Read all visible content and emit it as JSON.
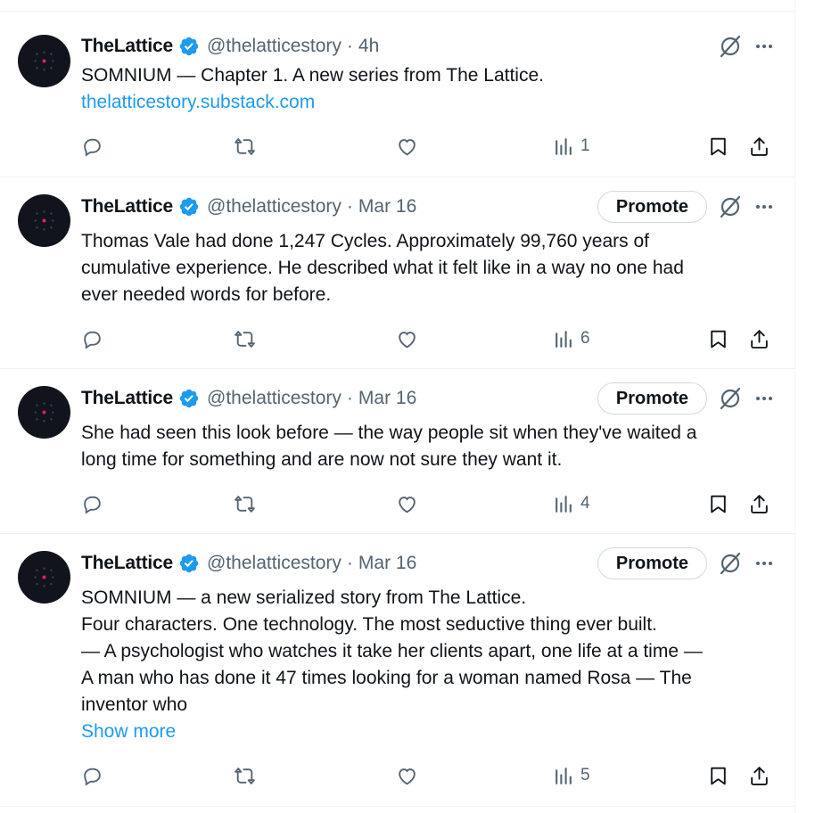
{
  "colors": {
    "text": "#0f1419",
    "muted": "#536471",
    "link": "#1d9bf0",
    "verified": "#1d9bf0",
    "border": "#eff3f4",
    "avatar_bg": "#12141d",
    "avatar_accent": "#e0245e"
  },
  "icons": {
    "verified": "verified-badge-icon",
    "grok": "grok-icon",
    "more": "more-dots-icon",
    "reply": "reply-icon",
    "repost": "repost-icon",
    "like": "like-icon",
    "views": "views-icon",
    "bookmark": "bookmark-icon",
    "share": "share-icon"
  },
  "tweets": [
    {
      "name": "TheLattice",
      "handle": "@thelatticestory",
      "separator": "·",
      "time": "4h",
      "promote": "",
      "lines": [
        "SOMNIUM — Chapter 1. A new series from The Lattice."
      ],
      "link": "thelatticestory.substack.com",
      "views": "1"
    },
    {
      "name": "TheLattice",
      "handle": "@thelatticestory",
      "separator": "·",
      "time": "Mar 16",
      "promote": "Promote",
      "lines": [
        "Thomas Vale had done 1,247 Cycles. Approximately 99,760 years of",
        "cumulative experience. He described what it felt like in a way no one had",
        "ever needed words for before."
      ],
      "link": "",
      "views": "6"
    },
    {
      "name": "TheLattice",
      "handle": "@thelatticestory",
      "separator": "·",
      "time": "Mar 16",
      "promote": "Promote",
      "lines": [
        "She had seen this look before — the way people sit when they've waited a",
        "long time for something and are now not sure they want it."
      ],
      "link": "",
      "views": "4"
    },
    {
      "name": "TheLattice",
      "handle": "@thelatticestory",
      "separator": "·",
      "time": "Mar 16",
      "promote": "Promote",
      "lines": [
        "SOMNIUM — a new serialized story from The Lattice.",
        "Four characters. One technology. The most seductive thing ever built.",
        "— A psychologist who watches it take her clients apart, one life at a time —",
        "A man who has done it 47 times looking for a woman named Rosa — The",
        "inventor who"
      ],
      "link": "Show more",
      "views": "5"
    }
  ]
}
